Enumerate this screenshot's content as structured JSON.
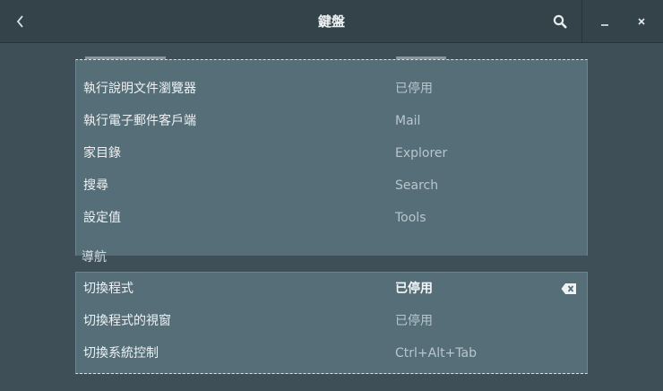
{
  "window": {
    "title": "鍵盤"
  },
  "icons": {
    "back": "go-previous-icon",
    "search": "search-icon",
    "minimize": "minimize-icon",
    "close": "close-icon",
    "clear": "edit-clear-icon"
  },
  "colors": {
    "headerbar": "#344249",
    "background": "#3e4f58",
    "list_bg": "#566e78",
    "text": "#eef2f4",
    "dim_text": "#b7c6cd"
  },
  "launchers": {
    "rows": [
      {
        "name": "執行說明文件瀏覽器",
        "accel": "已停用"
      },
      {
        "name": "執行電子郵件客戶端",
        "accel": "Mail"
      },
      {
        "name": "家目錄",
        "accel": "Explorer"
      },
      {
        "name": "搜尋",
        "accel": "Search"
      },
      {
        "name": "設定值",
        "accel": "Tools"
      }
    ]
  },
  "navigation": {
    "title": "導航",
    "rows": [
      {
        "name": "切換程式",
        "accel": "已停用"
      },
      {
        "name": "切換程式的視窗",
        "accel": "已停用"
      },
      {
        "name": "切換系統控制",
        "accel": "Ctrl+Alt+Tab"
      }
    ]
  }
}
